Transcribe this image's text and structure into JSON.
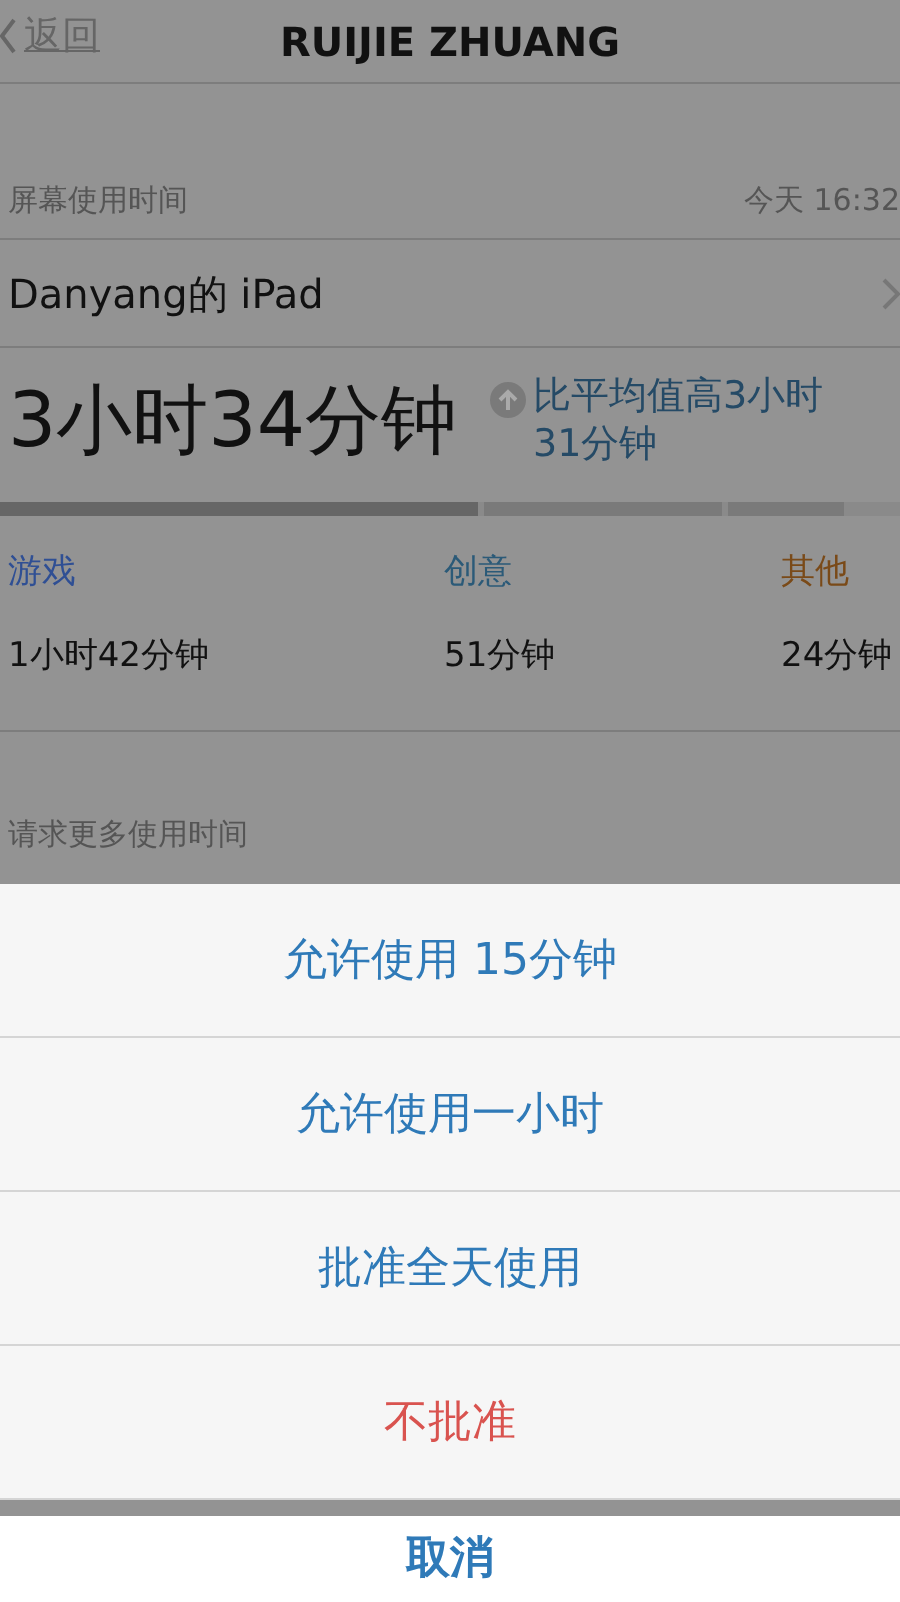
{
  "nav": {
    "back": "返回",
    "title": "RUIJIE ZHUANG"
  },
  "section_header": {
    "label": "屏幕使用时间",
    "time": "今天 16:32"
  },
  "device": {
    "name": "Danyang的 iPad"
  },
  "total": {
    "time": "3小时34分钟",
    "comparison": "比平均值高3小时31分钟"
  },
  "categories": [
    {
      "label": "游戏",
      "time": "1小时42分钟",
      "color": "#2f4f94"
    },
    {
      "label": "创意",
      "time": "51分钟",
      "color": "#2b5a78"
    },
    {
      "label": "其他",
      "time": "24分钟",
      "color": "#7a4a18"
    }
  ],
  "request_label": "请求更多使用时间",
  "action_sheet": {
    "actions": [
      {
        "label": "允许使用 15分钟",
        "kind": "normal"
      },
      {
        "label": "允许使用一小时",
        "kind": "normal"
      },
      {
        "label": "批准全天使用",
        "kind": "normal"
      },
      {
        "label": "不批准",
        "kind": "destructive"
      }
    ],
    "cancel": "取消"
  }
}
